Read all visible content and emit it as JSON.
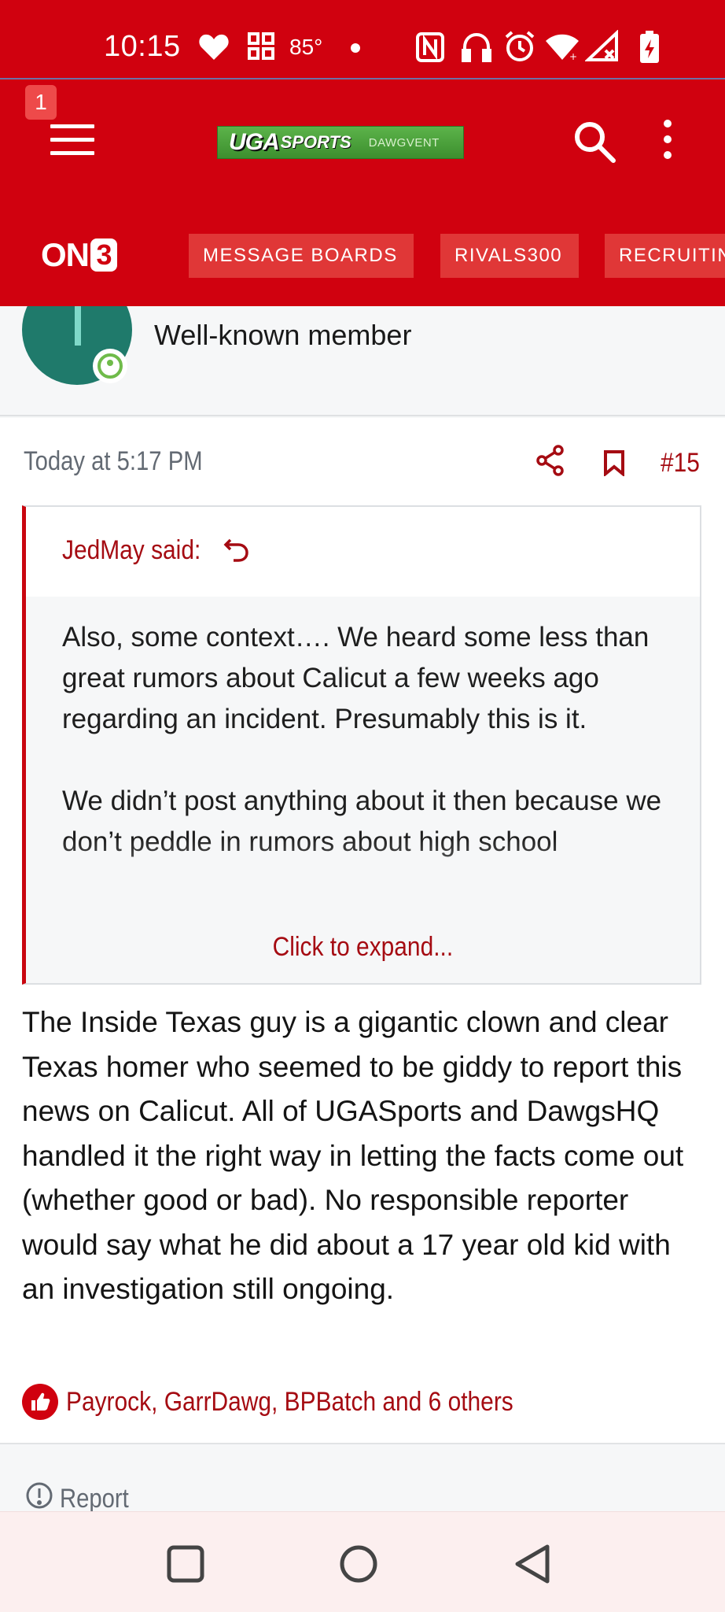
{
  "status_bar": {
    "time": "10:15",
    "temperature": "85°",
    "icons": [
      "heart-icon",
      "widgets-icon",
      "dot-icon",
      "nfc-icon",
      "headphones-icon",
      "alarm-icon",
      "wifi-icon",
      "signal-icon",
      "battery-charging-icon"
    ]
  },
  "header": {
    "notification_count": "1",
    "logo_main": "UGA",
    "logo_sports": "SPORTS",
    "logo_sub": "DAWGVENT",
    "brand_mark": "ON",
    "brand_mark_digit": "3",
    "nav_tabs": [
      {
        "label": "MESSAGE BOARDS"
      },
      {
        "label": "RIVALS300"
      },
      {
        "label": "RECRUITIN"
      }
    ]
  },
  "member": {
    "title": "Well-known member"
  },
  "post": {
    "timestamp": "Today at 5:17 PM",
    "number": "#15",
    "quote": {
      "author": "JedMay said:",
      "paragraphs": [
        "Also, some context…. We heard some less than great rumors about Calicut a few weeks ago regarding an incident. Presumably this is it.",
        "We didn’t post anything about it then because we don’t peddle in rumors about high school"
      ],
      "expand_label": "Click to expand..."
    },
    "body": "The Inside Texas guy is a gigantic clown and clear Texas homer who seemed to be giddy to report this news on Calicut. All of UGASports and DawgsHQ handled it the right way in letting the facts come out (whether good or bad). No responsible reporter would say what he did about a 17 year old kid with an investigation still ongoing.",
    "reactions": "Payrock, GarrDawg, BPBatch and 6 others",
    "report_label": "Report"
  },
  "colors": {
    "brand_red": "#d0010f",
    "link_red": "#a50b12",
    "logo_green": "#4aa33b"
  }
}
